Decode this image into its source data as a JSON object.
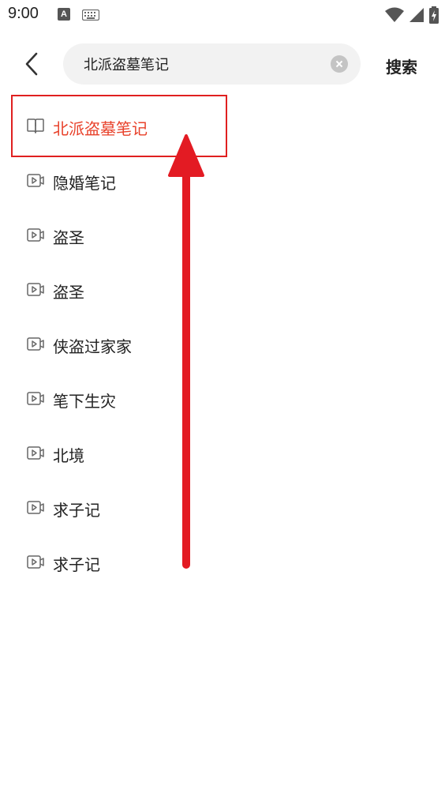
{
  "status_bar": {
    "time": "9:00",
    "left_icons": [
      "text-a-icon",
      "keyboard-icon"
    ],
    "right_icons": [
      "wifi-icon",
      "signal-icon",
      "battery-charging-icon"
    ]
  },
  "search": {
    "query": "北派盗墓笔记",
    "action_label": "搜索",
    "back_icon": "back-arrow-icon",
    "clear_icon": "clear-icon"
  },
  "suggestions": [
    {
      "label": "北派盗墓笔记",
      "icon": "book-icon",
      "highlighted": true
    },
    {
      "label": "隐婚笔记",
      "icon": "video-icon"
    },
    {
      "label": "盗圣",
      "icon": "video-icon"
    },
    {
      "label": "盗圣",
      "icon": "video-icon"
    },
    {
      "label": "侠盗过家家",
      "icon": "video-icon"
    },
    {
      "label": "笔下生灾",
      "icon": "video-icon"
    },
    {
      "label": "北境",
      "icon": "video-icon"
    },
    {
      "label": "求子记",
      "icon": "video-icon"
    },
    {
      "label": "求子记",
      "icon": "video-icon"
    }
  ],
  "colors": {
    "accent": "#e8412a",
    "annotation": "#e02020",
    "search_bg": "#f2f2f2"
  }
}
